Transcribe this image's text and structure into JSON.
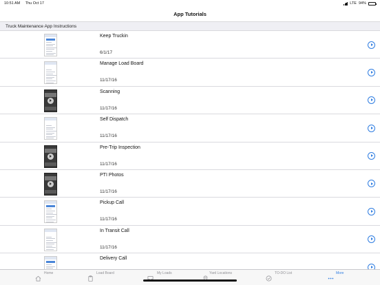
{
  "status_bar": {
    "time": "10:51 AM",
    "date": "Thu Oct 17",
    "network": "LTE",
    "battery": "94%",
    "battery_level": 0.94
  },
  "nav": {
    "title": "App Tutorials"
  },
  "section": {
    "title": "Truck Maintenance App Instructions"
  },
  "tutorials": [
    {
      "title": "Keep Truckin",
      "date": "6/1/17",
      "thumb": "light-blue"
    },
    {
      "title": "Manage Load Board",
      "date": "11/17/16",
      "thumb": "light"
    },
    {
      "title": "Scanning",
      "date": "11/17/16",
      "thumb": "dark-play"
    },
    {
      "title": "Self Dispatch",
      "date": "11/17/16",
      "thumb": "light"
    },
    {
      "title": "Pre-Trip Inspection",
      "date": "11/17/16",
      "thumb": "dark-play"
    },
    {
      "title": "PTI Photos",
      "date": "11/17/16",
      "thumb": "dark-play"
    },
    {
      "title": "Pickup Call",
      "date": "11/17/16",
      "thumb": "light-blue"
    },
    {
      "title": "In Transit Call",
      "date": "11/17/16",
      "thumb": "light"
    },
    {
      "title": "Delivery Call",
      "date": "",
      "thumb": "light-blue"
    }
  ],
  "tab_bar": {
    "tabs": [
      {
        "label": "Home",
        "icon": "home-icon"
      },
      {
        "label": "Load Board",
        "icon": "clipboard-icon"
      },
      {
        "label": "My Loads",
        "icon": "inbox-icon"
      },
      {
        "label": "Yard Locations",
        "icon": "map-pin-icon"
      },
      {
        "label": "TO-DO List",
        "icon": "checklist-icon"
      },
      {
        "label": "More",
        "icon": "more-dots-icon"
      }
    ],
    "active": "More"
  },
  "colors": {
    "accent": "#2f7de1",
    "section_bg": "#efeff4",
    "tab_inactive": "#8e8e93"
  }
}
